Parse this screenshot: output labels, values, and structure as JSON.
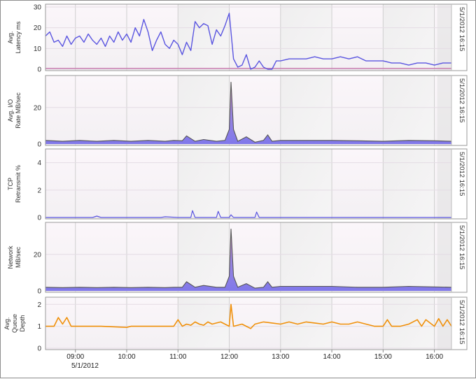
{
  "x_axis": {
    "ticks": [
      "09:00",
      "10:00",
      "11:00",
      "12:00",
      "13:00",
      "14:00",
      "15:00",
      "16:00"
    ],
    "date_label": "5/1/2012",
    "range": [
      "08:25",
      "16:20"
    ]
  },
  "panels": [
    {
      "key": "latency",
      "label_lines": [
        "Avg.",
        "Latency ms"
      ],
      "timestamp": "5/1/2012 16:15",
      "yticks": [
        "0",
        "10",
        "20",
        "30"
      ],
      "ylim": [
        0,
        30
      ]
    },
    {
      "key": "io",
      "label_lines": [
        "Avg. I/O",
        "Rate MB/sec"
      ],
      "timestamp": "5/1/2012 16:15",
      "yticks": [
        "0",
        "20"
      ],
      "ylim": [
        0,
        36
      ]
    },
    {
      "key": "tcp",
      "label_lines": [
        "TCP",
        "Retransmit  %"
      ],
      "timestamp": "5/1/2012 16:15",
      "yticks": [
        "0",
        "2",
        "4"
      ],
      "ylim": [
        0,
        4.8
      ]
    },
    {
      "key": "network",
      "label_lines": [
        "Network",
        "MB/sec"
      ],
      "timestamp": "5/1/2012 16:15",
      "yticks": [
        "0",
        "20"
      ],
      "ylim": [
        0,
        36
      ]
    },
    {
      "key": "queue",
      "label_lines": [
        "Avg.",
        "Queue",
        "Depth"
      ],
      "timestamp": "5/1/2012 16:15",
      "yticks": [
        "0",
        "1",
        "2"
      ],
      "ylim": [
        0,
        2.2
      ]
    }
  ],
  "colors": {
    "latency_line": "#5a55e0",
    "latency_base": "#c060a0",
    "io_outline": "#555555",
    "io_fill": "#8f80e8",
    "io_fill2": "#d89ab8",
    "tcp_line": "#5a55e0",
    "queue_line": "#f0900a",
    "panel_bg": "#f7f3f7",
    "shade": "#e6e6e6",
    "grid": "#cfcfcf"
  },
  "chart_data": [
    {
      "type": "line",
      "title": "",
      "ylabel": "Avg. Latency ms",
      "ylim": [
        0,
        30
      ],
      "grid": true,
      "series": [
        {
          "x": [
            "08:25",
            "08:30",
            "08:35",
            "08:40",
            "08:45",
            "08:50",
            "08:55",
            "09:00",
            "09:05",
            "09:10",
            "09:15",
            "09:20",
            "09:25",
            "09:30",
            "09:35",
            "09:40",
            "09:45",
            "09:50",
            "09:55",
            "10:00",
            "10:05",
            "10:10",
            "10:15",
            "10:20",
            "10:25",
            "10:30",
            "10:35",
            "10:40",
            "10:45",
            "10:50",
            "10:55",
            "11:00",
            "11:05",
            "11:10",
            "11:15",
            "11:20",
            "11:25",
            "11:30",
            "11:35",
            "11:40",
            "11:45",
            "11:50",
            "11:55",
            "12:00",
            "12:05",
            "12:10",
            "12:15",
            "12:20",
            "12:25",
            "12:30",
            "12:35",
            "12:40",
            "12:45",
            "12:50",
            "12:55",
            "13:00",
            "13:10",
            "13:20",
            "13:30",
            "13:40",
            "13:50",
            "14:00",
            "14:10",
            "14:20",
            "14:30",
            "14:40",
            "14:50",
            "15:00",
            "15:10",
            "15:20",
            "15:30",
            "15:40",
            "15:50",
            "16:00",
            "16:10",
            "16:20"
          ],
          "values": [
            16,
            18,
            13,
            14,
            11,
            16,
            12,
            15,
            16,
            13,
            17,
            14,
            12,
            15,
            11,
            16,
            13,
            18,
            14,
            17,
            13,
            20,
            16,
            24,
            18,
            9,
            14,
            18,
            12,
            10,
            14,
            12,
            7,
            13,
            9,
            23,
            20,
            22,
            21,
            12,
            19,
            16,
            21,
            27,
            5,
            1,
            2,
            7,
            0,
            1,
            4,
            1,
            0,
            0,
            4,
            4,
            5,
            5,
            5,
            6,
            5,
            5,
            6,
            5,
            6,
            4,
            4,
            4,
            3,
            3,
            2,
            3,
            3,
            2,
            3,
            3
          ]
        }
      ]
    },
    {
      "type": "area",
      "title": "",
      "ylabel": "Avg. I/O Rate MB/sec",
      "ylim": [
        0,
        36
      ],
      "grid": true,
      "series": [
        {
          "x": [
            "08:25",
            "08:45",
            "09:05",
            "09:25",
            "09:45",
            "10:05",
            "10:25",
            "10:45",
            "10:55",
            "11:05",
            "11:10",
            "11:20",
            "11:30",
            "11:45",
            "11:55",
            "12:00",
            "12:02",
            "12:05",
            "12:10",
            "12:20",
            "12:30",
            "12:40",
            "12:45",
            "12:50",
            "13:00",
            "13:30",
            "14:00",
            "14:30",
            "15:00",
            "15:30",
            "16:00",
            "16:20"
          ],
          "values": [
            2,
            1.5,
            2,
            1.5,
            2,
            1.5,
            2,
            1.5,
            2,
            1.8,
            4.5,
            1.5,
            2.5,
            1.5,
            2,
            8,
            34,
            8,
            1.5,
            4,
            1,
            2,
            5,
            1.5,
            2,
            2,
            2,
            1.8,
            1.5,
            2,
            1.8,
            1.5
          ]
        }
      ]
    },
    {
      "type": "line",
      "title": "",
      "ylabel": "TCP Retransmit  %",
      "ylim": [
        0,
        4.8
      ],
      "grid": true,
      "series": [
        {
          "x": [
            "08:25",
            "09:20",
            "09:25",
            "09:30",
            "10:40",
            "10:45",
            "11:00",
            "11:15",
            "11:17",
            "11:20",
            "11:45",
            "11:47",
            "11:50",
            "12:00",
            "12:02",
            "12:05",
            "12:30",
            "12:32",
            "12:35",
            "16:20"
          ],
          "values": [
            0,
            0,
            0.1,
            0,
            0,
            0.05,
            0,
            0,
            0.5,
            0,
            0,
            0.45,
            0,
            0,
            0.2,
            0,
            0,
            0.4,
            0,
            0
          ]
        }
      ]
    },
    {
      "type": "area",
      "title": "",
      "ylabel": "Network MB/sec",
      "ylim": [
        0,
        36
      ],
      "grid": true,
      "series": [
        {
          "x": [
            "08:25",
            "08:45",
            "09:05",
            "09:25",
            "09:45",
            "10:05",
            "10:25",
            "10:45",
            "10:55",
            "11:05",
            "11:10",
            "11:20",
            "11:30",
            "11:45",
            "11:55",
            "12:00",
            "12:02",
            "12:05",
            "12:10",
            "12:20",
            "12:30",
            "12:40",
            "12:45",
            "12:50",
            "13:00",
            "13:30",
            "14:00",
            "14:30",
            "15:00",
            "15:30",
            "16:00",
            "16:20"
          ],
          "values": [
            2,
            1.8,
            2,
            1.8,
            2,
            1.8,
            2,
            1.8,
            2,
            2,
            5,
            2,
            3,
            2,
            2,
            8,
            34,
            8,
            2,
            4,
            1.5,
            2,
            5,
            2,
            2.5,
            2.5,
            2.5,
            2,
            2,
            2.5,
            2.2,
            2
          ]
        }
      ]
    },
    {
      "type": "line",
      "title": "",
      "ylabel": "Avg. Queue Depth",
      "ylim": [
        0,
        2.2
      ],
      "grid": true,
      "series": [
        {
          "x": [
            "08:25",
            "08:35",
            "08:40",
            "08:45",
            "08:50",
            "08:55",
            "09:00",
            "09:30",
            "10:00",
            "10:05",
            "10:30",
            "10:55",
            "11:00",
            "11:05",
            "11:10",
            "11:15",
            "11:20",
            "11:25",
            "11:30",
            "11:35",
            "11:40",
            "11:45",
            "11:50",
            "11:55",
            "12:00",
            "12:02",
            "12:05",
            "12:15",
            "12:20",
            "12:25",
            "12:30",
            "12:40",
            "12:50",
            "13:00",
            "13:10",
            "13:20",
            "13:30",
            "13:40",
            "13:50",
            "14:00",
            "14:10",
            "14:20",
            "14:30",
            "14:40",
            "14:50",
            "15:00",
            "15:05",
            "15:10",
            "15:20",
            "15:30",
            "15:40",
            "15:45",
            "15:50",
            "16:00",
            "16:05",
            "16:10",
            "16:15",
            "16:20"
          ],
          "values": [
            1,
            1,
            1.4,
            1.1,
            1.4,
            1,
            1,
            1,
            0.95,
            1,
            1,
            1,
            1.3,
            1,
            1.1,
            1.05,
            1.2,
            1.1,
            1.05,
            1.2,
            1.1,
            1.15,
            1.2,
            1.1,
            1,
            2,
            1,
            1.1,
            1,
            0.9,
            1.1,
            1.2,
            1.15,
            1.1,
            1.2,
            1.1,
            1.2,
            1.15,
            1.1,
            1.2,
            1.1,
            1.1,
            1.2,
            1.1,
            1,
            1,
            1.3,
            1,
            1,
            1.1,
            1.3,
            1,
            1.3,
            1,
            1.35,
            1,
            1.3,
            1
          ]
        }
      ]
    }
  ]
}
